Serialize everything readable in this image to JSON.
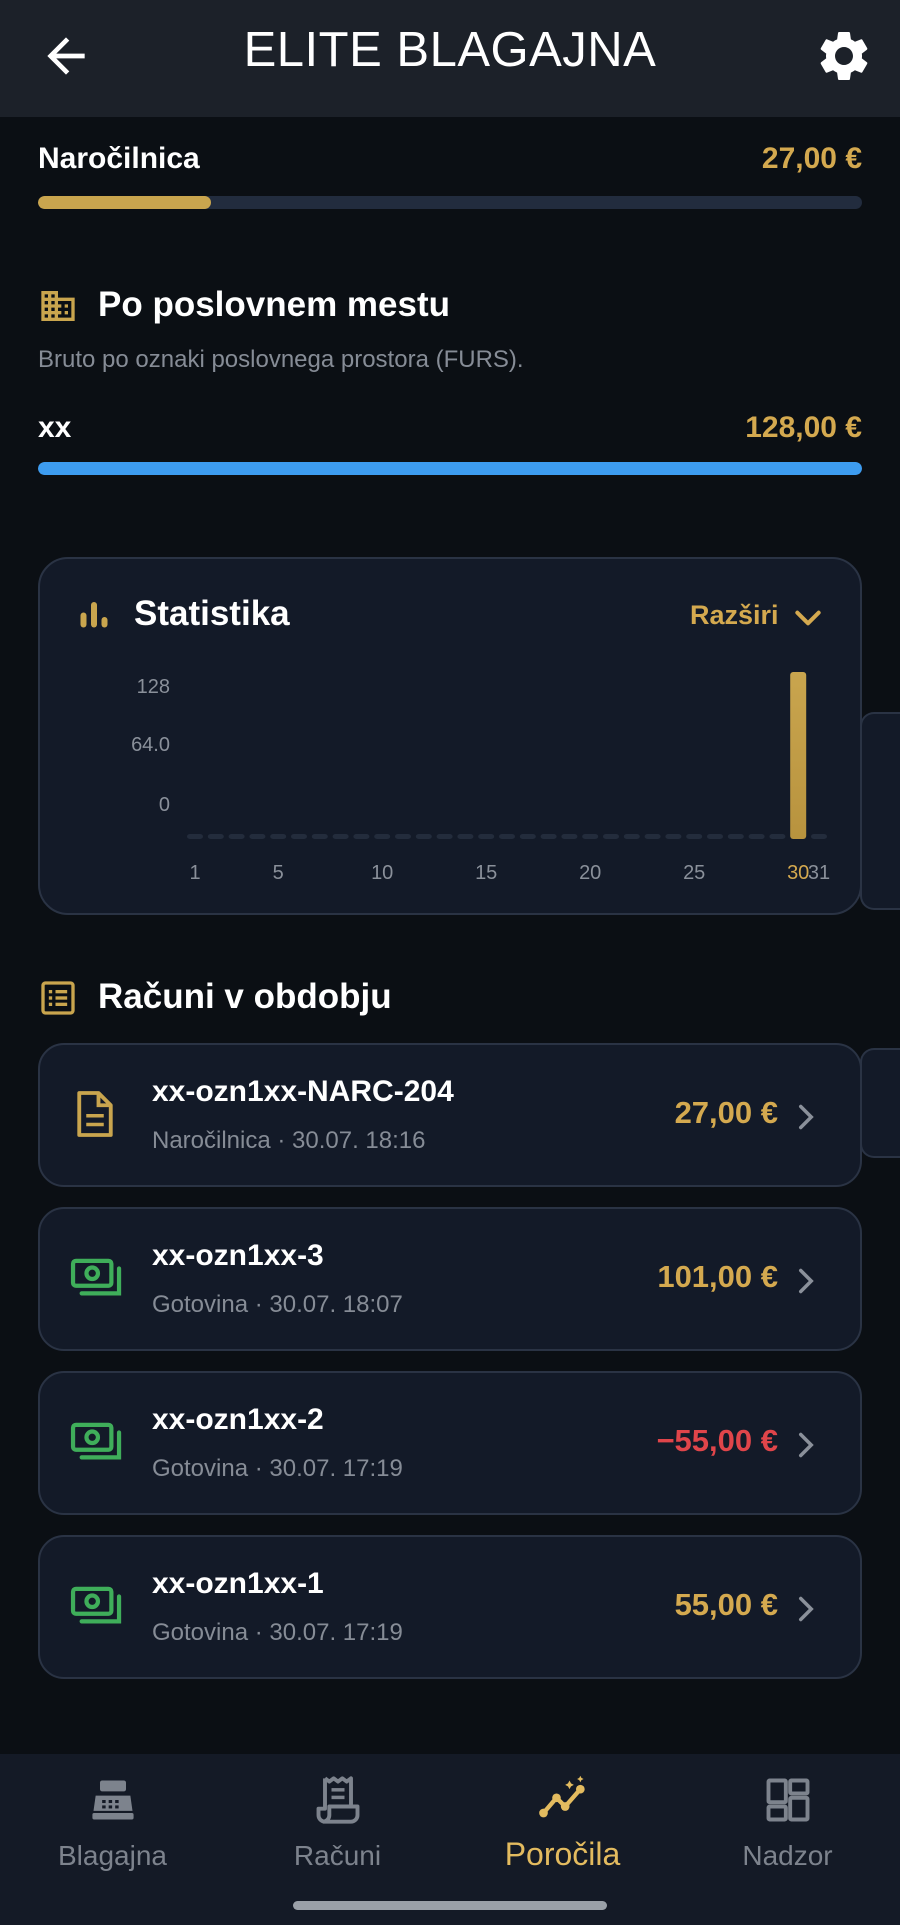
{
  "header": {
    "title": "ELITE BLAGAJNA",
    "back_icon": "arrow-left-icon",
    "settings_icon": "gear-icon"
  },
  "narocilnica_row": {
    "label": "Naročilnica",
    "value": "27,00 €",
    "share": 0.21,
    "fill_color": "#c9a54e"
  },
  "business_premises": {
    "title": "Po poslovnem mestu",
    "subtitle": "Bruto po oznaki poslovnega prostora (FURS).",
    "icon": "building-icon",
    "rows": [
      {
        "label": "xx",
        "value": "128,00 €",
        "share": 1.0,
        "fill_color": "#3d9cf0"
      }
    ]
  },
  "statistics": {
    "title": "Statistika",
    "expand_label": "Razširi",
    "icon": "bar-chart-icon",
    "chevron_icon": "chevron-down-icon"
  },
  "chart_data": {
    "type": "bar",
    "categories": [
      "1",
      "2",
      "3",
      "4",
      "5",
      "6",
      "7",
      "8",
      "9",
      "10",
      "11",
      "12",
      "13",
      "14",
      "15",
      "16",
      "17",
      "18",
      "19",
      "20",
      "21",
      "22",
      "23",
      "24",
      "25",
      "26",
      "27",
      "28",
      "29",
      "30",
      "31"
    ],
    "values": [
      0,
      0,
      0,
      0,
      0,
      0,
      0,
      0,
      0,
      0,
      0,
      0,
      0,
      0,
      0,
      0,
      0,
      0,
      0,
      0,
      0,
      0,
      0,
      0,
      0,
      0,
      0,
      0,
      0,
      128,
      0
    ],
    "x_tick_labels": [
      "1",
      "5",
      "10",
      "15",
      "20",
      "25",
      "30",
      "31"
    ],
    "y_tick_labels": [
      "128",
      "64.0",
      "0"
    ],
    "ylim": [
      0,
      128
    ],
    "highlight_category": "30",
    "bar_color": "#b8933e",
    "grid": false,
    "title": "",
    "xlabel": "",
    "ylabel": ""
  },
  "receipts_section": {
    "title": "Računi v obdobju",
    "icon": "list-icon"
  },
  "receipts": [
    {
      "id": "xx-ozn1xx-NARC-204",
      "meta": "Naročilnica · 30.07. 18:16",
      "amount": "27,00 €",
      "negative": false,
      "icon": "document-icon"
    },
    {
      "id": "xx-ozn1xx-3",
      "meta": "Gotovina · 30.07. 18:07",
      "amount": "101,00 €",
      "negative": false,
      "icon": "cash-icon"
    },
    {
      "id": "xx-ozn1xx-2",
      "meta": "Gotovina · 30.07. 17:19",
      "amount": "−55,00 €",
      "negative": true,
      "icon": "cash-icon"
    },
    {
      "id": "xx-ozn1xx-1",
      "meta": "Gotovina · 30.07. 17:19",
      "amount": "55,00 €",
      "negative": false,
      "icon": "cash-icon"
    }
  ],
  "bottom_nav": {
    "items": [
      {
        "label": "Blagajna",
        "icon": "cash-register-icon",
        "active": false
      },
      {
        "label": "Računi",
        "icon": "receipt-icon",
        "active": false
      },
      {
        "label": "Poročila",
        "icon": "analytics-icon",
        "active": true
      },
      {
        "label": "Nadzor",
        "icon": "dashboard-icon",
        "active": false
      }
    ]
  },
  "colors": {
    "accent_gold": "#d4a94f",
    "negative_red": "#e0454a",
    "cash_green": "#3fae5a",
    "progress_blue": "#3d9cf0"
  }
}
